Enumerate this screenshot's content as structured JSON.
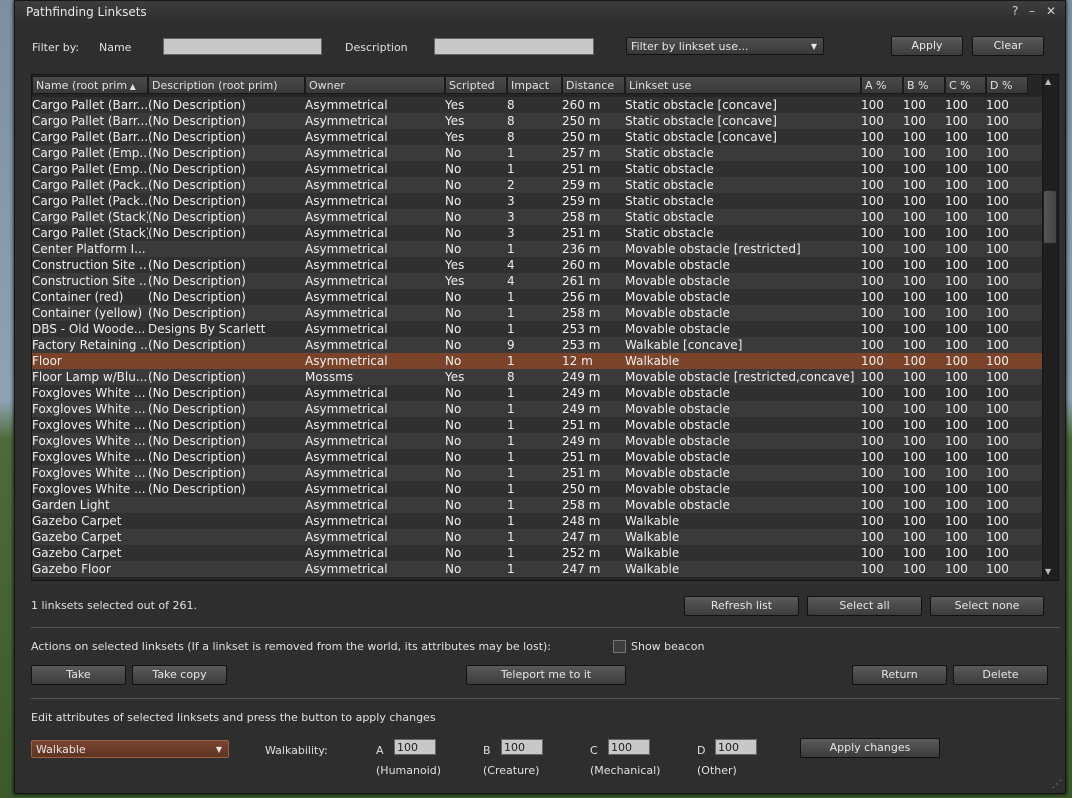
{
  "window": {
    "title": "Pathfinding Linksets"
  },
  "filter": {
    "filter_by_label": "Filter by:",
    "name_label": "Name",
    "name_value": "",
    "description_label": "Description",
    "description_value": "",
    "use_combo": "Filter by linkset use...",
    "apply_label": "Apply",
    "clear_label": "Clear"
  },
  "table": {
    "columns": [
      "Name (root prim",
      "Description (root prim)",
      "Owner",
      "Scripted",
      "Impact",
      "Distance",
      "Linkset use",
      "A %",
      "B %",
      "C %",
      "D %"
    ],
    "rows": [
      [
        "Cargo Pallet (Barr...",
        "(No Description)",
        "Asymmetrical",
        "Yes",
        "8",
        "260 m",
        "Static obstacle [concave]",
        "100",
        "100",
        "100",
        "100"
      ],
      [
        "Cargo Pallet (Barr...",
        "(No Description)",
        "Asymmetrical",
        "Yes",
        "8",
        "250 m",
        "Static obstacle [concave]",
        "100",
        "100",
        "100",
        "100"
      ],
      [
        "Cargo Pallet (Barr...",
        "(No Description)",
        "Asymmetrical",
        "Yes",
        "8",
        "250 m",
        "Static obstacle [concave]",
        "100",
        "100",
        "100",
        "100"
      ],
      [
        "Cargo Pallet (Emp...",
        "(No Description)",
        "Asymmetrical",
        "No",
        "1",
        "257 m",
        "Static obstacle",
        "100",
        "100",
        "100",
        "100"
      ],
      [
        "Cargo Pallet (Emp...",
        "(No Description)",
        "Asymmetrical",
        "No",
        "1",
        "251 m",
        "Static obstacle",
        "100",
        "100",
        "100",
        "100"
      ],
      [
        "Cargo Pallet (Pack...",
        "(No Description)",
        "Asymmetrical",
        "No",
        "2",
        "259 m",
        "Static obstacle",
        "100",
        "100",
        "100",
        "100"
      ],
      [
        "Cargo Pallet (Pack...",
        "(No Description)",
        "Asymmetrical",
        "No",
        "3",
        "259 m",
        "Static obstacle",
        "100",
        "100",
        "100",
        "100"
      ],
      [
        "Cargo Pallet (Stack)",
        "(No Description)",
        "Asymmetrical",
        "No",
        "3",
        "258 m",
        "Static obstacle",
        "100",
        "100",
        "100",
        "100"
      ],
      [
        "Cargo Pallet (Stack)",
        "(No Description)",
        "Asymmetrical",
        "No",
        "3",
        "251 m",
        "Static obstacle",
        "100",
        "100",
        "100",
        "100"
      ],
      [
        "Center Platform I...",
        "",
        "Asymmetrical",
        "No",
        "1",
        "236 m",
        "Movable obstacle [restricted]",
        "100",
        "100",
        "100",
        "100"
      ],
      [
        "Construction Site ...",
        "(No Description)",
        "Asymmetrical",
        "Yes",
        "4",
        "260 m",
        "Movable obstacle",
        "100",
        "100",
        "100",
        "100"
      ],
      [
        "Construction Site ...",
        "(No Description)",
        "Asymmetrical",
        "Yes",
        "4",
        "261 m",
        "Movable obstacle",
        "100",
        "100",
        "100",
        "100"
      ],
      [
        "Container (red)",
        "(No Description)",
        "Asymmetrical",
        "No",
        "1",
        "256 m",
        "Movable obstacle",
        "100",
        "100",
        "100",
        "100"
      ],
      [
        "Container (yellow)",
        "(No Description)",
        "Asymmetrical",
        "No",
        "1",
        "258 m",
        "Movable obstacle",
        "100",
        "100",
        "100",
        "100"
      ],
      [
        "DBS - Old Woode...",
        "Designs By Scarlett",
        "Asymmetrical",
        "No",
        "1",
        "253 m",
        "Movable obstacle",
        "100",
        "100",
        "100",
        "100"
      ],
      [
        "Factory Retaining ...",
        "(No Description)",
        "Asymmetrical",
        "No",
        "9",
        "253 m",
        "Walkable [concave]",
        "100",
        "100",
        "100",
        "100"
      ],
      [
        "Floor",
        "",
        "Asymmetrical",
        "No",
        "1",
        "12 m",
        "Walkable",
        "100",
        "100",
        "100",
        "100"
      ],
      [
        "Floor Lamp w/Blu...",
        "(No Description)",
        "Mossms",
        "Yes",
        "8",
        "249 m",
        "Movable obstacle [restricted,concave]",
        "100",
        "100",
        "100",
        "100"
      ],
      [
        "Foxgloves White ...",
        "(No Description)",
        "Asymmetrical",
        "No",
        "1",
        "249 m",
        "Movable obstacle",
        "100",
        "100",
        "100",
        "100"
      ],
      [
        "Foxgloves White ...",
        "(No Description)",
        "Asymmetrical",
        "No",
        "1",
        "249 m",
        "Movable obstacle",
        "100",
        "100",
        "100",
        "100"
      ],
      [
        "Foxgloves White ...",
        "(No Description)",
        "Asymmetrical",
        "No",
        "1",
        "251 m",
        "Movable obstacle",
        "100",
        "100",
        "100",
        "100"
      ],
      [
        "Foxgloves White ...",
        "(No Description)",
        "Asymmetrical",
        "No",
        "1",
        "249 m",
        "Movable obstacle",
        "100",
        "100",
        "100",
        "100"
      ],
      [
        "Foxgloves White ...",
        "(No Description)",
        "Asymmetrical",
        "No",
        "1",
        "251 m",
        "Movable obstacle",
        "100",
        "100",
        "100",
        "100"
      ],
      [
        "Foxgloves White ...",
        "(No Description)",
        "Asymmetrical",
        "No",
        "1",
        "251 m",
        "Movable obstacle",
        "100",
        "100",
        "100",
        "100"
      ],
      [
        "Foxgloves White ...",
        "(No Description)",
        "Asymmetrical",
        "No",
        "1",
        "250 m",
        "Movable obstacle",
        "100",
        "100",
        "100",
        "100"
      ],
      [
        "Garden Light",
        "",
        "Asymmetrical",
        "No",
        "1",
        "258 m",
        "Movable obstacle",
        "100",
        "100",
        "100",
        "100"
      ],
      [
        "Gazebo Carpet",
        "",
        "Asymmetrical",
        "No",
        "1",
        "248 m",
        "Walkable",
        "100",
        "100",
        "100",
        "100"
      ],
      [
        "Gazebo Carpet",
        "",
        "Asymmetrical",
        "No",
        "1",
        "247 m",
        "Walkable",
        "100",
        "100",
        "100",
        "100"
      ],
      [
        "Gazebo Carpet",
        "",
        "Asymmetrical",
        "No",
        "1",
        "252 m",
        "Walkable",
        "100",
        "100",
        "100",
        "100"
      ],
      [
        "Gazebo Floor",
        "",
        "Asymmetrical",
        "No",
        "1",
        "247 m",
        "Walkable",
        "100",
        "100",
        "100",
        "100"
      ]
    ],
    "selected_row": 16
  },
  "status": {
    "selection_text": "1 linksets selected out of 261.",
    "refresh_label": "Refresh list",
    "select_all_label": "Select all",
    "select_none_label": "Select none"
  },
  "actions": {
    "heading": "Actions on selected linksets (If a linkset is removed from the world, its attributes may be lost):",
    "show_beacon_label": "Show beacon",
    "take_label": "Take",
    "take_copy_label": "Take copy",
    "teleport_label": "Teleport me to it",
    "return_label": "Return",
    "delete_label": "Delete"
  },
  "edit": {
    "heading": "Edit attributes of selected linksets and press the button to apply changes",
    "use_value": "Walkable",
    "walkability_label": "Walkability:",
    "fields": [
      {
        "letter": "A",
        "value": "100",
        "caption": "(Humanoid)"
      },
      {
        "letter": "B",
        "value": "100",
        "caption": "(Creature)"
      },
      {
        "letter": "C",
        "value": "100",
        "caption": "(Mechanical)"
      },
      {
        "letter": "D",
        "value": "100",
        "caption": "(Other)"
      }
    ],
    "apply_changes_label": "Apply changes"
  },
  "colors": {
    "selected_row": "#7b4329",
    "row_even": "#3a3a3a",
    "row_odd": "#303030",
    "use_combo_selected": "#6a3a26"
  },
  "icons": [
    "help-icon",
    "minimize-icon",
    "close-icon",
    "sort-ascending-icon",
    "scroll-up-icon",
    "scroll-down-icon",
    "dropdown-arrow-icon",
    "resize-grip-icon"
  ]
}
